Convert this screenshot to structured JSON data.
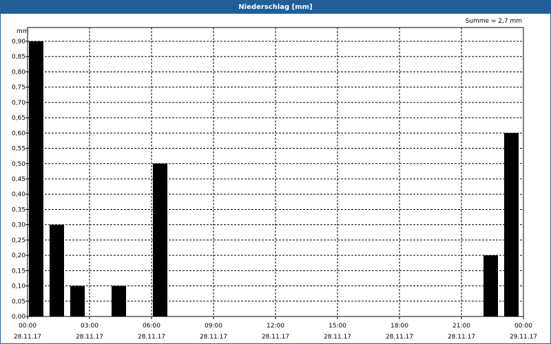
{
  "window": {
    "title": "Niederschlag [mm]"
  },
  "summary": "Summe = 2,7 mm",
  "chart_data": {
    "type": "bar",
    "title": "Niederschlag [mm]",
    "ylabel": "mm",
    "xlabel": "",
    "ylim": [
      0,
      0.9
    ],
    "xlim_hours": [
      0,
      24
    ],
    "grid": true,
    "bar_color": "#000000",
    "y_ticks": [
      "0,00",
      "0,05",
      "0,10",
      "0,15",
      "0,20",
      "0,25",
      "0,30",
      "0,35",
      "0,40",
      "0,45",
      "0,50",
      "0,55",
      "0,60",
      "0,65",
      "0,70",
      "0,75",
      "0,80",
      "0,85",
      "0,90"
    ],
    "x_ticks": [
      {
        "time": "00:00",
        "date": "28.11.17",
        "hour": 0
      },
      {
        "time": "03:00",
        "date": "28.11.17",
        "hour": 3
      },
      {
        "time": "06:00",
        "date": "28.11.17",
        "hour": 6
      },
      {
        "time": "09:00",
        "date": "28.11.17",
        "hour": 9
      },
      {
        "time": "12:00",
        "date": "28.11.17",
        "hour": 12
      },
      {
        "time": "15:00",
        "date": "28.11.17",
        "hour": 15
      },
      {
        "time": "18:00",
        "date": "28.11.17",
        "hour": 18
      },
      {
        "time": "21:00",
        "date": "28.11.17",
        "hour": 21
      },
      {
        "time": "00:00",
        "date": "29.11.17",
        "hour": 24
      }
    ],
    "bars": [
      {
        "hour": 0,
        "value": 0.9
      },
      {
        "hour": 1,
        "value": 0.3
      },
      {
        "hour": 2,
        "value": 0.1
      },
      {
        "hour": 4,
        "value": 0.1
      },
      {
        "hour": 6,
        "value": 0.5
      },
      {
        "hour": 22,
        "value": 0.2
      },
      {
        "hour": 23,
        "value": 0.6
      }
    ]
  }
}
